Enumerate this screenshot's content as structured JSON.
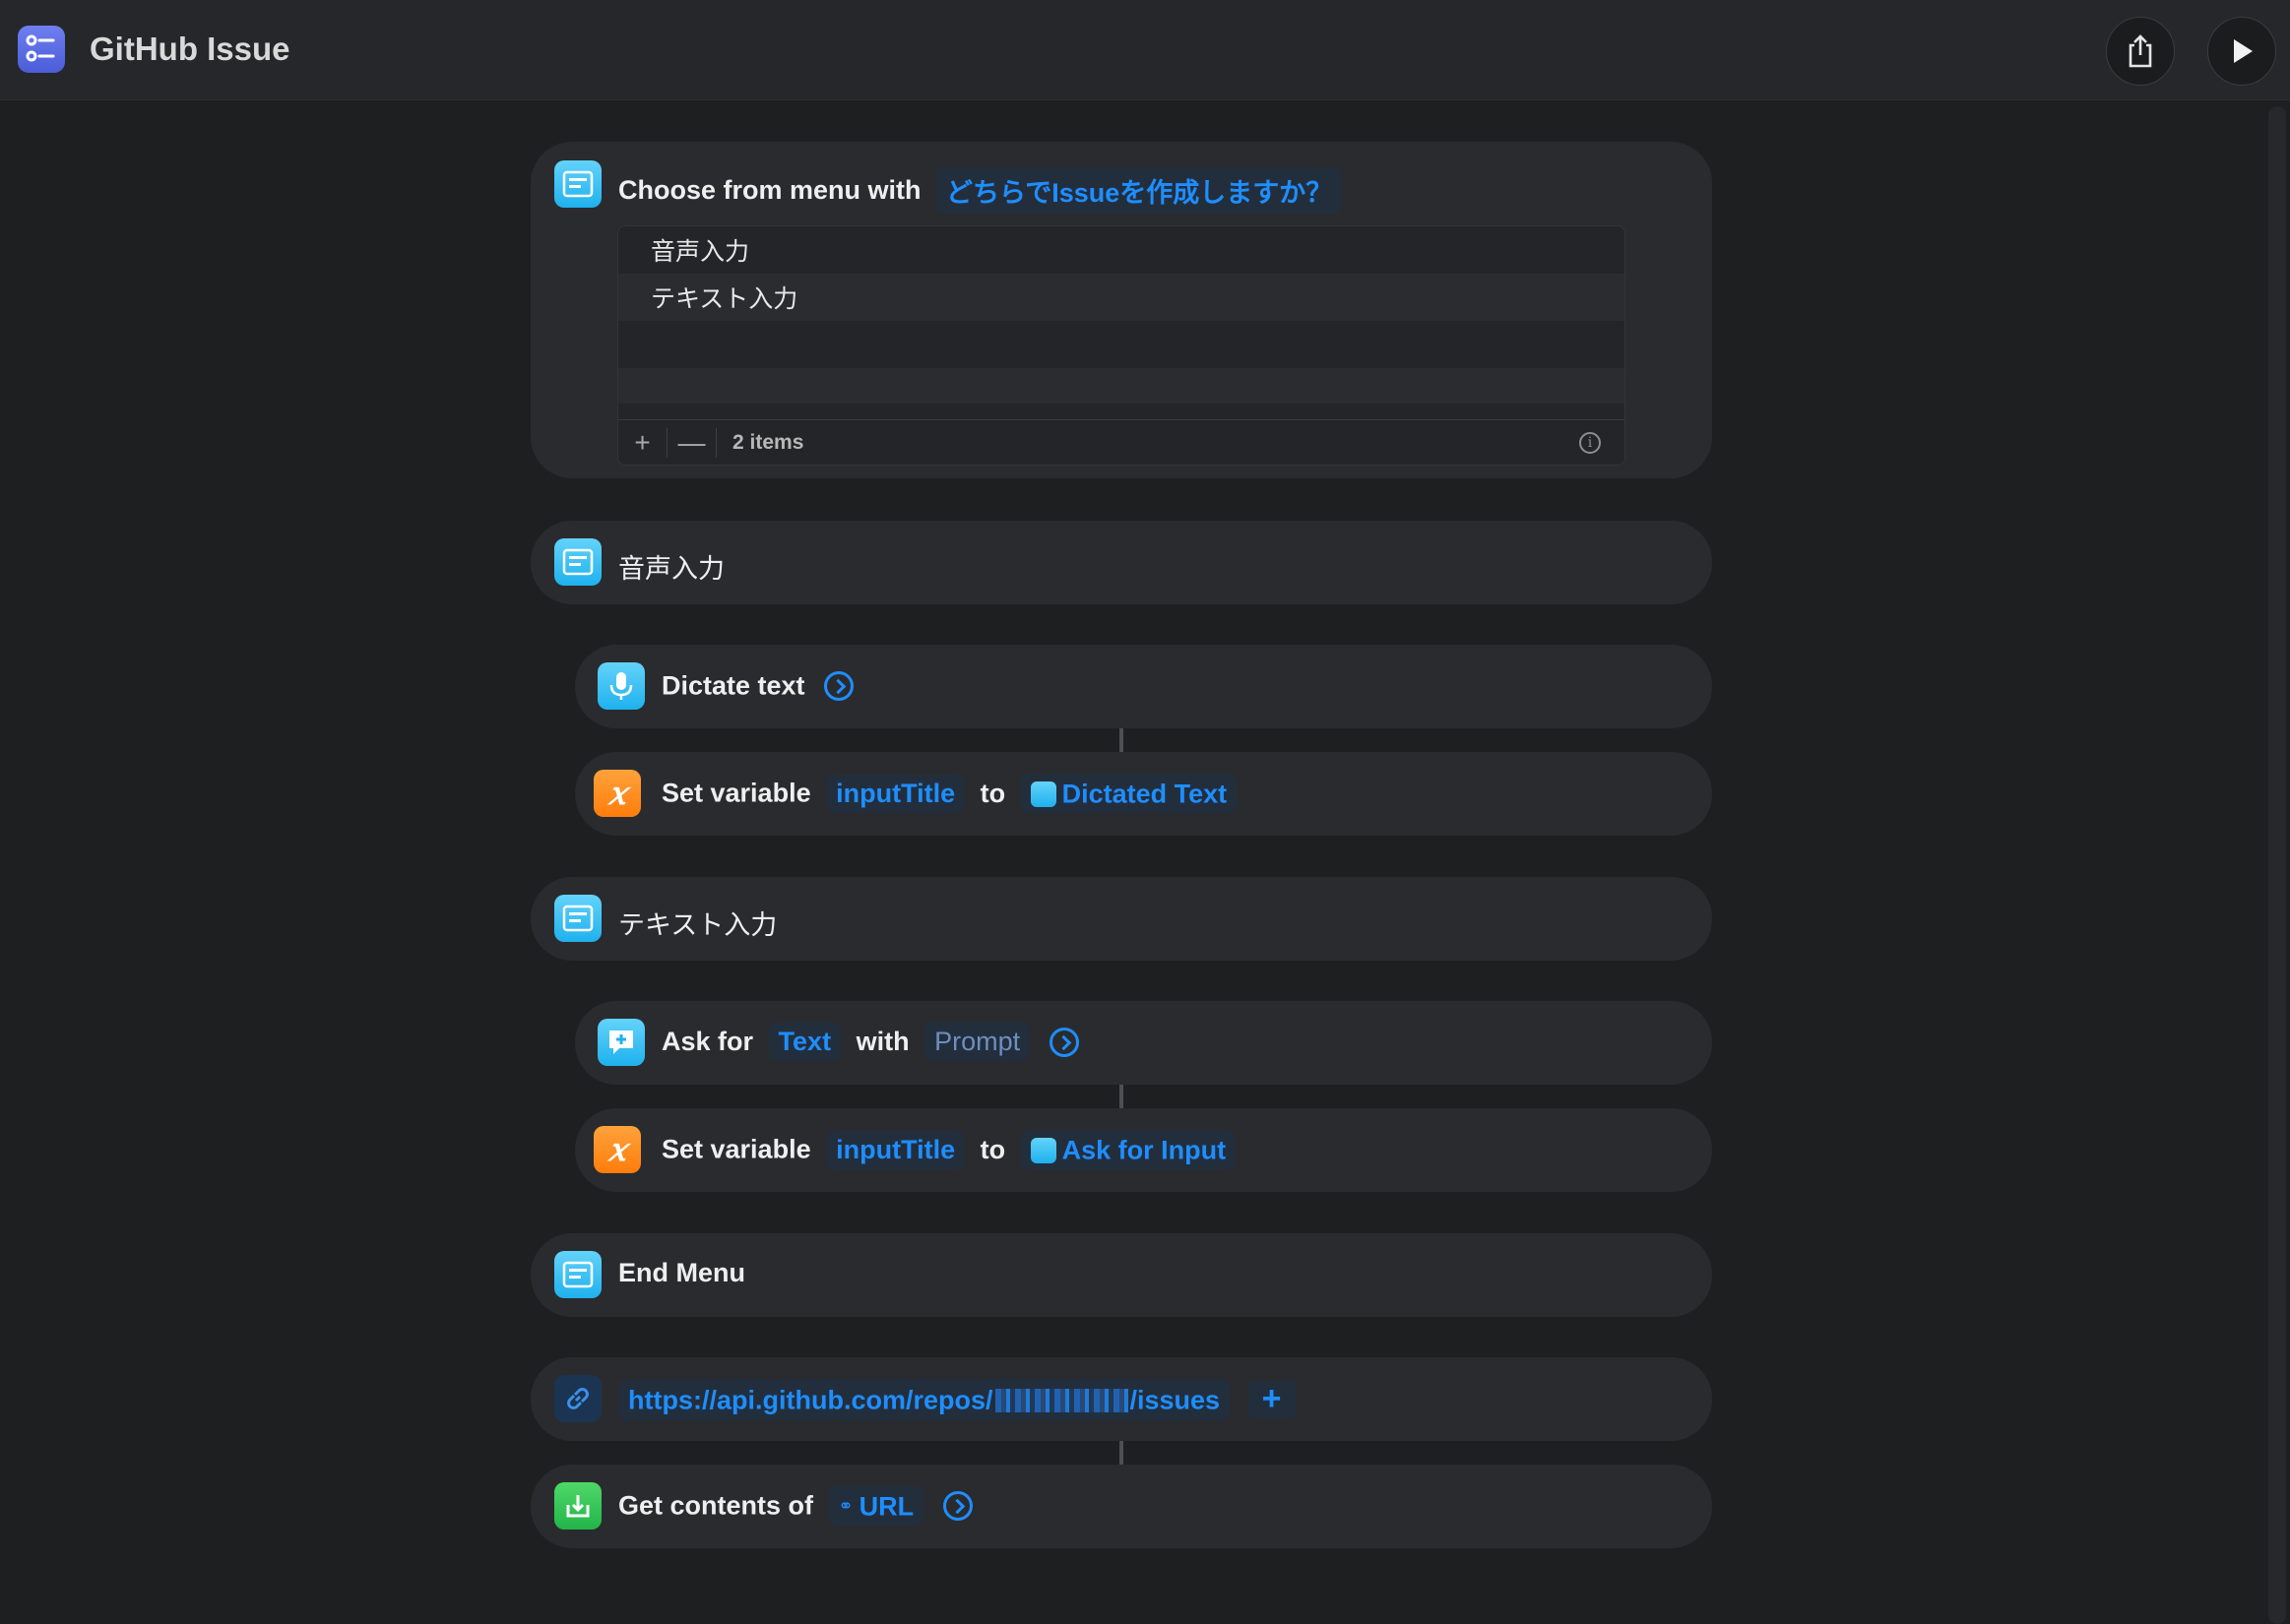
{
  "window": {
    "title": "GitHub Issue"
  },
  "menu_block": {
    "label": "Choose from menu with",
    "prompt": "どちらでIssueを作成しますか？",
    "items": [
      "音声入力",
      "テキスト入力"
    ],
    "add_symbol": "+",
    "remove_symbol": "—",
    "count_label": "2 items",
    "info_symbol": "i"
  },
  "case1": {
    "label": "音声入力",
    "dictate": {
      "label": "Dictate text"
    },
    "set_var": {
      "label": "Set variable",
      "var": "inputTitle",
      "to": "to",
      "value": "Dictated Text"
    }
  },
  "case2": {
    "label": "テキスト入力",
    "ask": {
      "label": "Ask for",
      "type": "Text",
      "with": "with",
      "prompt": "Prompt"
    },
    "set_var": {
      "label": "Set variable",
      "var": "inputTitle",
      "to": "to",
      "value": "Ask for Input"
    }
  },
  "end_menu": {
    "label": "End Menu"
  },
  "url_block": {
    "url_prefix": "https://api.github.com/repos/",
    "url_suffix": "/issues",
    "add_symbol": "+"
  },
  "get_contents": {
    "label": "Get contents of",
    "value": "URL"
  },
  "icons": {
    "app": "checklist-icon",
    "menu": "menu-icon",
    "mic": "microphone-icon",
    "variable": "variable-x-icon",
    "ask": "speech-bubble-plus-icon",
    "link": "link-icon",
    "download": "download-tray-icon",
    "share": "share-icon",
    "play": "play-icon"
  },
  "colors": {
    "accent": "#1e8eff",
    "cyan_tile": "#1fb1ee",
    "orange_tile": "#ff7d0c",
    "green_tile": "#22b449"
  }
}
